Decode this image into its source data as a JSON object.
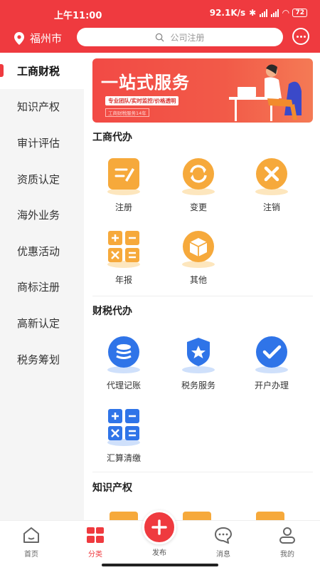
{
  "status_bar": {
    "time": "上午11:00",
    "speed": "92.1K/s",
    "battery": "72"
  },
  "header": {
    "city": "福州市",
    "search_placeholder": "公司注册"
  },
  "sidebar": {
    "items": [
      {
        "label": "工商财税",
        "active": true
      },
      {
        "label": "知识产权",
        "active": false
      },
      {
        "label": "审计评估",
        "active": false
      },
      {
        "label": "资质认定",
        "active": false
      },
      {
        "label": "海外业务",
        "active": false
      },
      {
        "label": "优惠活动",
        "active": false
      },
      {
        "label": "商标注册",
        "active": false
      },
      {
        "label": "高新认定",
        "active": false
      },
      {
        "label": "税务筹划",
        "active": false
      }
    ]
  },
  "banner": {
    "title": "一站式服务",
    "subtitle": "专业团队/实时监控/价格透明",
    "note": "工商财税服务14年"
  },
  "sections": [
    {
      "title": "工商代办",
      "items": [
        {
          "label": "注册",
          "icon": "edit-icon"
        },
        {
          "label": "变更",
          "icon": "refresh-icon"
        },
        {
          "label": "注销",
          "icon": "close-icon"
        },
        {
          "label": "年报",
          "icon": "calculator-icon"
        },
        {
          "label": "其他",
          "icon": "box-icon"
        }
      ]
    },
    {
      "title": "财税代办",
      "items": [
        {
          "label": "代理记账",
          "icon": "coins-icon"
        },
        {
          "label": "税务服务",
          "icon": "police-badge-icon"
        },
        {
          "label": "开户办理",
          "icon": "check-icon"
        },
        {
          "label": "汇算清缴",
          "icon": "calculator-icon"
        }
      ]
    },
    {
      "title": "知识产权",
      "items": []
    }
  ],
  "bottom_nav": {
    "items": [
      {
        "label": "首页",
        "icon": "home-icon"
      },
      {
        "label": "分类",
        "icon": "category-icon",
        "active": true
      },
      {
        "label": "发布",
        "icon": "plus-icon"
      },
      {
        "label": "消息",
        "icon": "message-icon"
      },
      {
        "label": "我的",
        "icon": "user-icon"
      }
    ]
  },
  "colors": {
    "brand": "#ef3a3f",
    "accent_orange": "#f6a93b",
    "accent_blue": "#2f74e8"
  }
}
